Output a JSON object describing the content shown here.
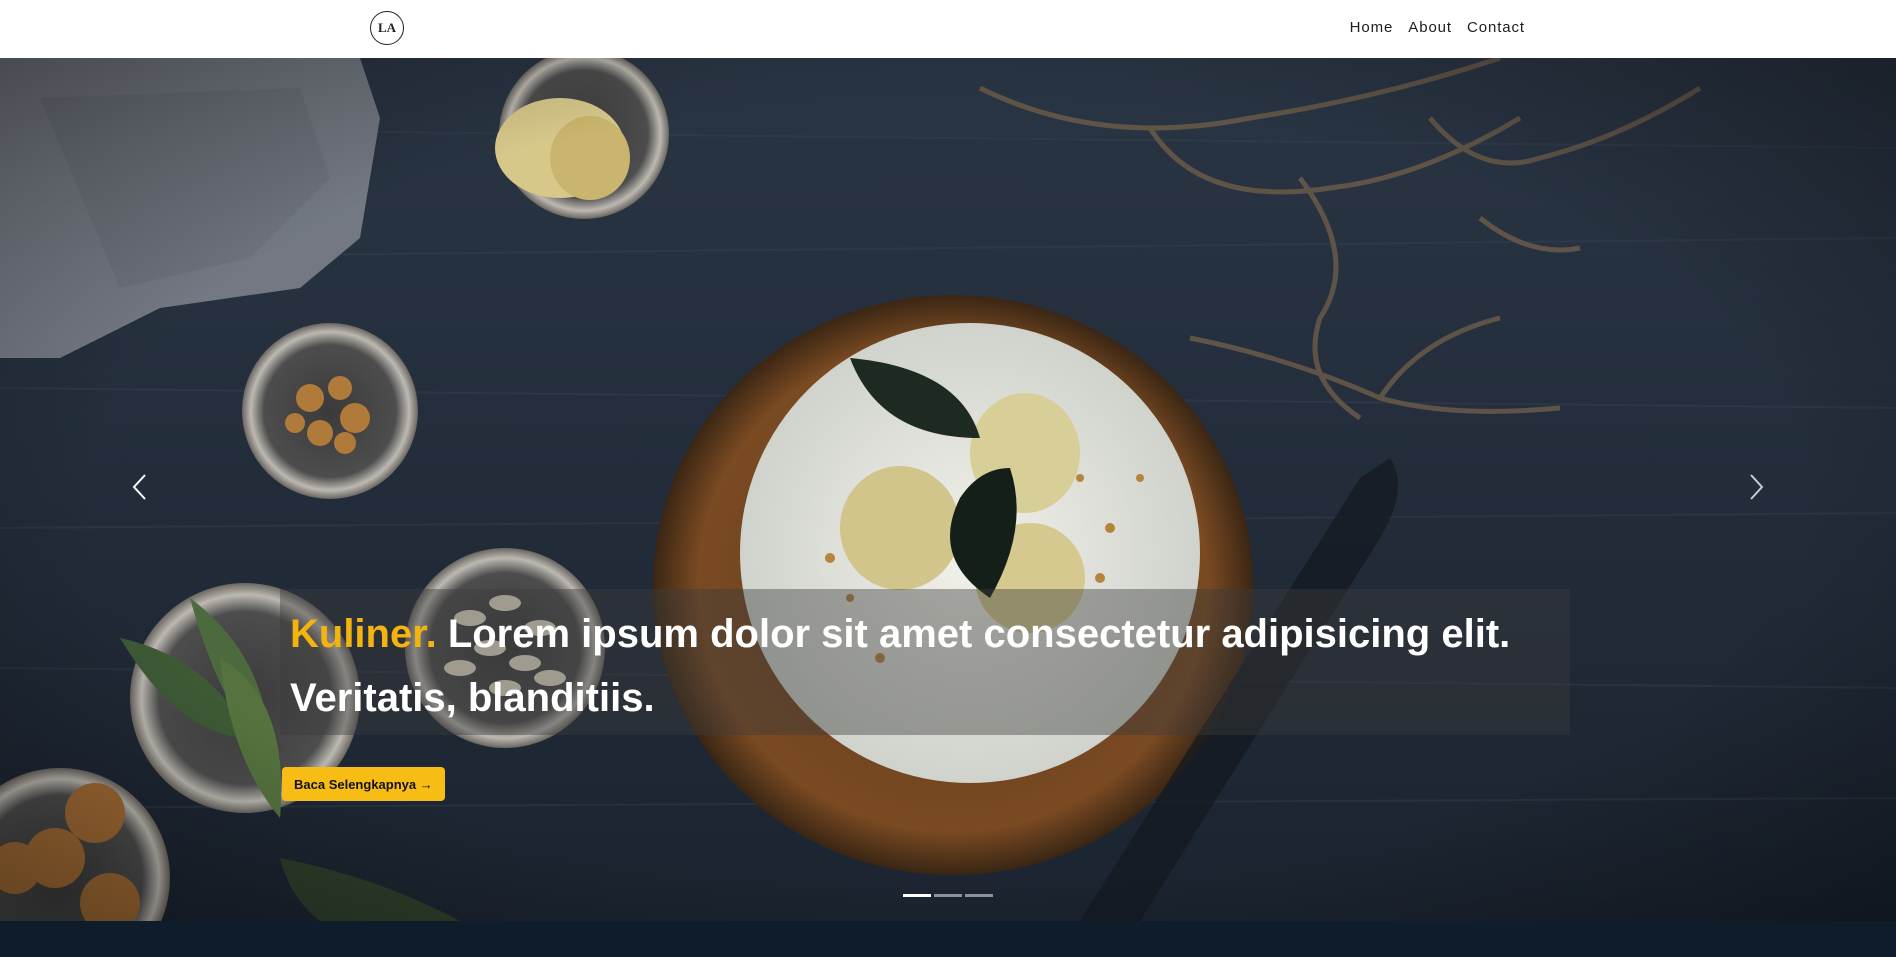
{
  "logo": {
    "text": "LA"
  },
  "nav": {
    "items": [
      {
        "label": "Home"
      },
      {
        "label": "About"
      },
      {
        "label": "Contact"
      }
    ]
  },
  "hero": {
    "caption_accent": "Kuliner.",
    "caption_line1": " Lorem ipsum dolor sit amet consectetur adipisicing elit.",
    "caption_line2": "Veritatis, blanditiis.",
    "cta_label": "Baca Selengkapnya →",
    "prev_icon": "chevron-left-icon",
    "next_icon": "chevron-right-icon",
    "slides_count": 3,
    "active_slide": 1
  },
  "colors": {
    "accent": "#f3b410",
    "button": "#f8bd14",
    "navbar_bg": "#ffffff",
    "footer_bg": "#0f1c2b",
    "hero_bg": "#1f2a36"
  }
}
